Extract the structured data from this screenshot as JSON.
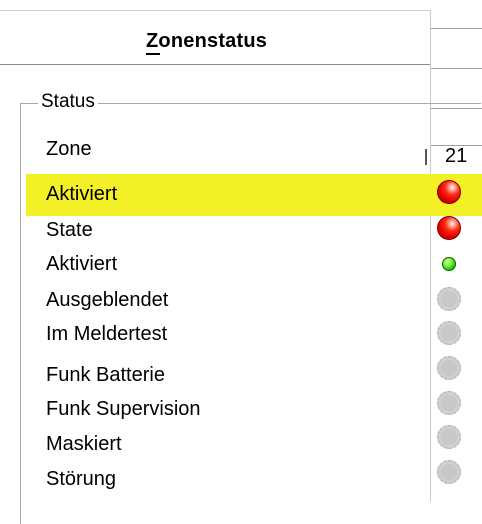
{
  "dialog": {
    "title": "Zonenstatus",
    "title_mnemonic": "Z"
  },
  "status_group": {
    "label": "Status",
    "column_header": "21",
    "rows": [
      {
        "label": "Zone",
        "indicator": "none"
      },
      {
        "label": "Aktiviert",
        "indicator": "red",
        "highlighted": true
      },
      {
        "label": "State",
        "indicator": "red"
      },
      {
        "label": "Aktiviert",
        "indicator": "green"
      },
      {
        "label": "Ausgeblendet",
        "indicator": "gray"
      },
      {
        "label": "Im Meldertest",
        "indicator": "gray"
      },
      {
        "label": "Funk Batterie",
        "indicator": "gray"
      },
      {
        "label": "Funk Supervision",
        "indicator": "gray"
      },
      {
        "label": "Maskiert",
        "indicator": "gray"
      },
      {
        "label": "Störung",
        "indicator": "gray"
      }
    ]
  },
  "colors": {
    "highlight": "#f4f027",
    "indicator_red": "#e00000",
    "indicator_green": "#22d400",
    "indicator_gray": "#cfcfcf"
  }
}
